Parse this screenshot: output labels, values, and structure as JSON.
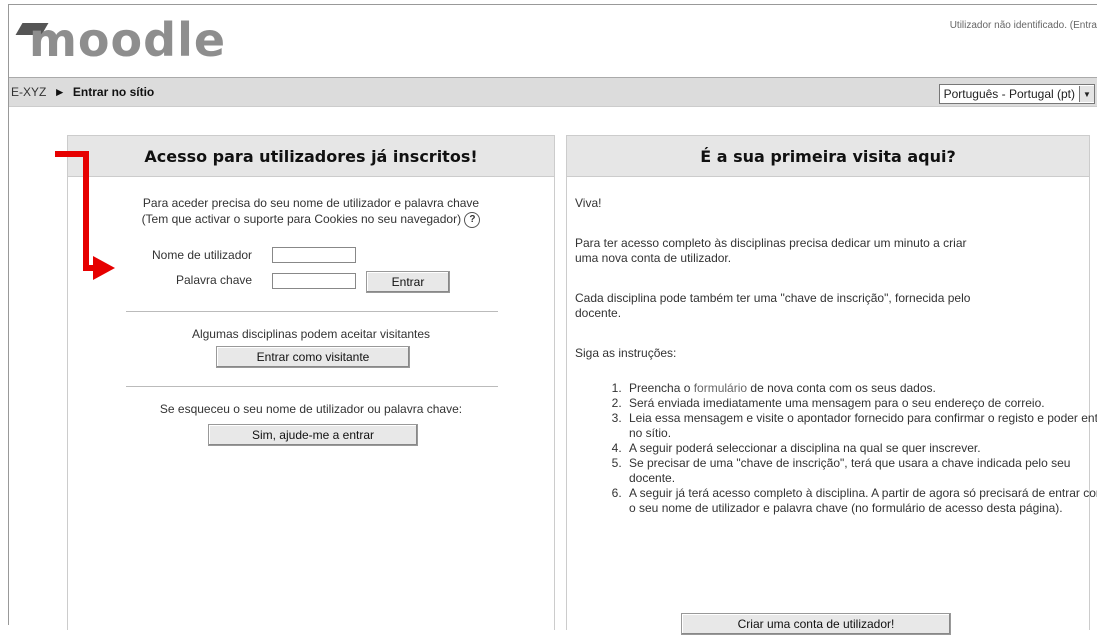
{
  "header": {
    "logo_text": "moodle",
    "user_status": "Utilizador não identificado. (Entra"
  },
  "navbar": {
    "breadcrumb_home": "E-XYZ",
    "breadcrumb_sep": "►",
    "breadcrumb_current": "Entrar no sítio",
    "language_selected": "Português - Portugal (pt)"
  },
  "login": {
    "title": "Acesso para utilizadores já inscritos!",
    "desc_line1": "Para aceder precisa do seu nome de utilizador e palavra chave",
    "desc_line2": "(Tem que activar o suporte para Cookies no seu navegador)",
    "help_glyph": "?",
    "username_label": "Nome de utilizador",
    "password_label": "Palavra chave",
    "submit_label": "Entrar",
    "guest_text": "Algumas disciplinas podem aceitar visitantes",
    "guest_button": "Entrar como visitante",
    "forgot_text": "Se esqueceu o seu nome de utilizador ou palavra chave:",
    "forgot_button": "Sim, ajude-me a entrar"
  },
  "signup": {
    "title": "É a sua primeira visita aqui?",
    "greeting": "Viva!",
    "para1_line1": "Para ter acesso completo às disciplinas precisa dedicar um minuto a criar",
    "para1_line2": "uma nova conta de utilizador.",
    "para2_line1": "Cada disciplina pode também ter uma \"chave de inscrição\", fornecida pelo",
    "para2_line2": "docente.",
    "instructions_label": "Siga as instruções:",
    "step1_pre": "Preencha o ",
    "step1_link": "formulário",
    "step1_post": " de nova conta com os seus dados.",
    "step2": "Será enviada imediatamente uma mensagem para o seu endereço de correio.",
    "step3": "Leia essa mensagem e visite o apontador fornecido para confirmar o registo e poder entrar no sítio.",
    "step4": "A seguir poderá seleccionar a disciplina na qual se quer inscrever.",
    "step5": "Se precisar de uma \"chave de inscrição\", terá que usara a chave indicada pelo seu docente.",
    "step6": "A seguir já terá acesso completo à disciplina. A partir de agora só precisará de entrar com o seu nome de utilizador e palavra chave (no formulário de acesso desta página).",
    "create_button": "Criar uma conta de utilizador!"
  },
  "colors": {
    "annotation_arrow": "#e60000",
    "box_header_bg": "#e6e6e6",
    "navbar_bg": "#dcdcdc"
  }
}
